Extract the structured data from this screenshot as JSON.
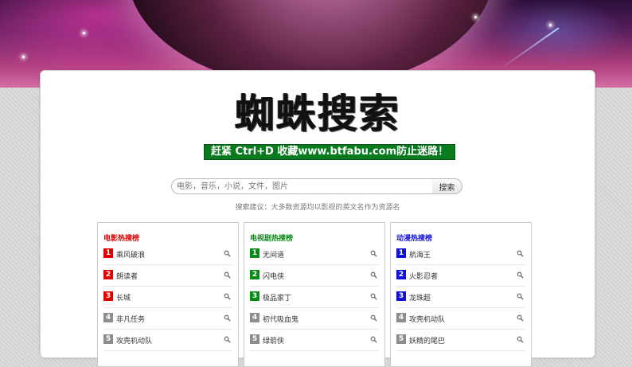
{
  "logo": {
    "text": "蜘蛛搜索"
  },
  "notice": {
    "text": "赶紧 Ctrl+D 收藏www.btfabu.com防止迷路！"
  },
  "search": {
    "placeholder": "电影，音乐，小说，文件，图片",
    "button_label": "搜索",
    "tip": "搜索建议：大多数资源均以影视的英文名作为资源名"
  },
  "colors": {
    "movie": "#e00000",
    "tv": "#0a8a16",
    "anime": "#1010d8",
    "gray": "#8c8c8c",
    "notice_bg": "#0a7a1f"
  },
  "lists": [
    {
      "title": "电影热搜榜",
      "color": "#e00000",
      "items": [
        {
          "rank": "1",
          "name": "乘风破浪"
        },
        {
          "rank": "2",
          "name": "朗读者"
        },
        {
          "rank": "3",
          "name": "长城"
        },
        {
          "rank": "4",
          "name": "非凡任务"
        },
        {
          "rank": "5",
          "name": "攻壳机动队"
        }
      ]
    },
    {
      "title": "电视剧热搜榜",
      "color": "#0a8a16",
      "items": [
        {
          "rank": "1",
          "name": "无间道"
        },
        {
          "rank": "2",
          "name": "闪电侠"
        },
        {
          "rank": "3",
          "name": "极品家丁"
        },
        {
          "rank": "4",
          "name": "初代吸血鬼"
        },
        {
          "rank": "5",
          "name": "绿箭侠"
        }
      ]
    },
    {
      "title": "动漫热搜榜",
      "color": "#1010d8",
      "items": [
        {
          "rank": "1",
          "name": "航海王"
        },
        {
          "rank": "2",
          "name": "火影忍者"
        },
        {
          "rank": "3",
          "name": "龙珠超"
        },
        {
          "rank": "4",
          "name": "攻壳机动队"
        },
        {
          "rank": "5",
          "name": "妖精的尾巴"
        }
      ]
    }
  ]
}
